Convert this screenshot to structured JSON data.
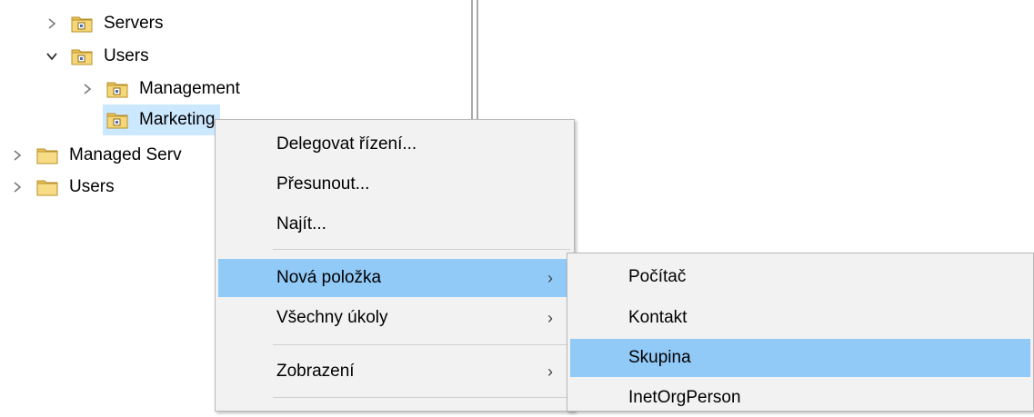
{
  "tree": {
    "items": [
      {
        "label": "Servers",
        "arrow": "collapsed"
      },
      {
        "label": "Users",
        "arrow": "expanded"
      },
      {
        "label": "Management",
        "arrow": "collapsed"
      },
      {
        "label": "Marketing",
        "arrow": "none"
      },
      {
        "label": "Managed Serv",
        "arrow": "collapsed"
      },
      {
        "label": "Users",
        "arrow": "collapsed"
      }
    ]
  },
  "context_menu": {
    "items": [
      {
        "label": "Delegovat řízení..."
      },
      {
        "label": "Přesunout..."
      },
      {
        "label": "Najít..."
      },
      {
        "label": "Nová položka",
        "submenu": "›"
      },
      {
        "label": "Všechny úkoly",
        "submenu": "›"
      },
      {
        "label": "Zobrazení",
        "submenu": "›"
      }
    ]
  },
  "submenu": {
    "items": [
      {
        "label": "Počítač"
      },
      {
        "label": "Kontakt"
      },
      {
        "label": "Skupina"
      },
      {
        "label": "InetOrgPerson"
      }
    ]
  },
  "colors": {
    "selection": "#cce8ff",
    "menu_highlight": "#91c9f7",
    "menu_background": "#f2f2f2"
  }
}
